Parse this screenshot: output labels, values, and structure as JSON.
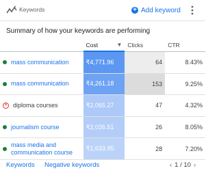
{
  "header": {
    "title": "Keywords",
    "add_label": "Add keyword"
  },
  "summary": "Summary of how your keywords are performing",
  "table": {
    "columns": [
      "Cost",
      "Clicks",
      "CTR"
    ],
    "rows": [
      {
        "keyword": "mass communication",
        "status": "enabled",
        "cost": "₹4,771.96",
        "clicks": "64",
        "ctr": "8.43%"
      },
      {
        "keyword": "mass communication",
        "status": "enabled",
        "cost": "₹4,261.18",
        "clicks": "153",
        "ctr": "9.25%"
      },
      {
        "keyword": "diploma courses",
        "status": "removed",
        "cost": "₹2,065.27",
        "clicks": "47",
        "ctr": "4.32%"
      },
      {
        "keyword": "journalism course",
        "status": "enabled",
        "cost": "₹2,026.51",
        "clicks": "26",
        "ctr": "8.05%"
      },
      {
        "keyword": "mass media and communication course",
        "status": "enabled",
        "cost": "₹1,633.95",
        "clicks": "28",
        "ctr": "7.20%"
      }
    ]
  },
  "footer": {
    "link1": "Keywords",
    "link2": "Negative keywords",
    "page": "1 / 10"
  },
  "colors": {
    "accent": "#1a73e8",
    "enabled_dot": "#188038",
    "removed": "#d93025"
  }
}
